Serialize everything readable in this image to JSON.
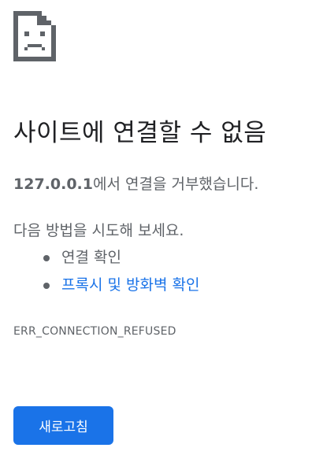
{
  "title": "사이트에 연결할 수 없음",
  "message": {
    "host": "127.0.0.1",
    "text": "에서 연결을 거부했습니다."
  },
  "suggestions": {
    "intro": "다음 방법을 시도해 보세요.",
    "items": [
      {
        "label": "연결 확인",
        "is_link": false
      },
      {
        "label": "프록시 및 방화벽 확인",
        "is_link": true
      }
    ]
  },
  "error_code": "ERR_CONNECTION_REFUSED",
  "reload_button": {
    "label": "새로고침"
  },
  "icons": {
    "error": "sad-page-icon"
  },
  "colors": {
    "text": "#202124",
    "secondary_text": "#5f6368",
    "link": "#1a73e8",
    "button": "#1a73e8"
  }
}
